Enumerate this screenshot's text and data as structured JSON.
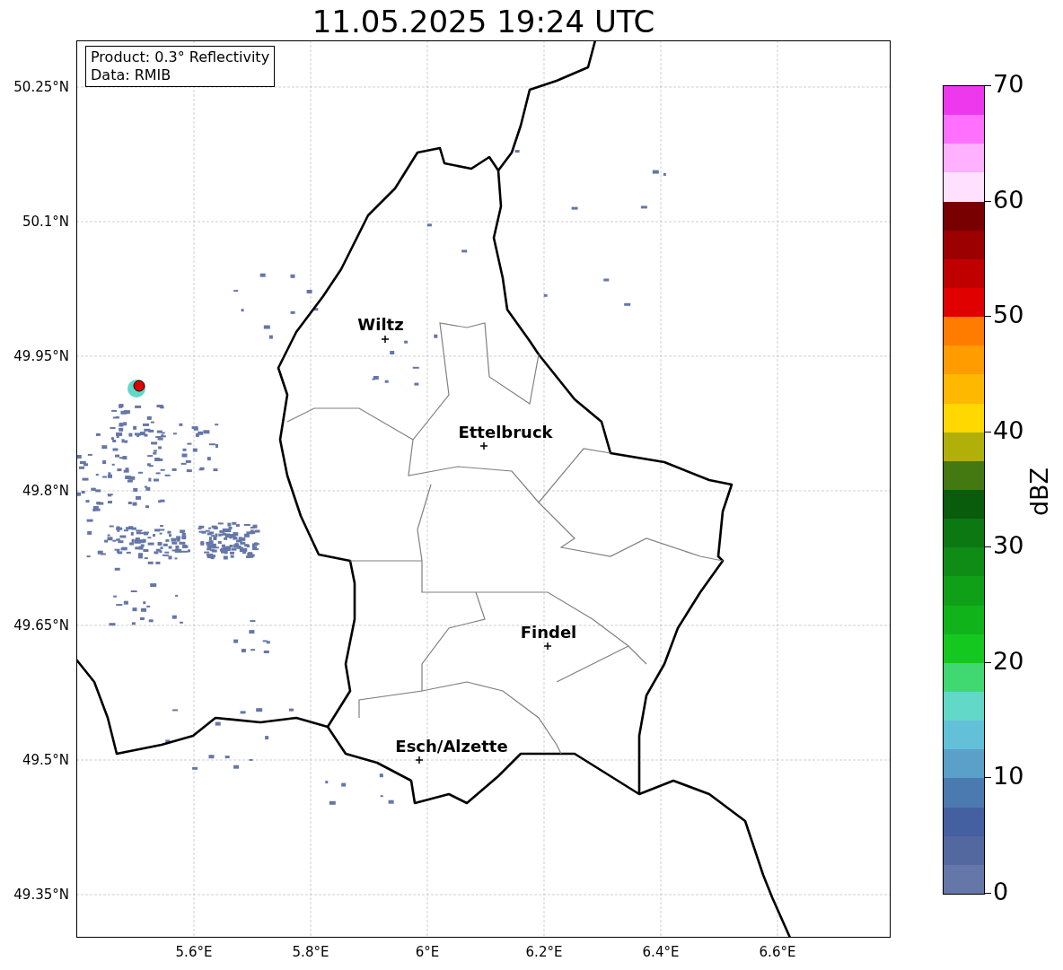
{
  "title": "11.05.2025 19:24 UTC",
  "info_box": [
    "Product: 0.3° Reflectivity",
    "Data: RMIB"
  ],
  "map": {
    "y_ticks": [
      "50.25°N",
      "50.1°N",
      "49.95°N",
      "49.8°N",
      "49.65°N",
      "49.5°N",
      "49.35°N"
    ],
    "x_ticks": [
      "5.6°E",
      "5.8°E",
      "6°E",
      "6.2°E",
      "6.4°E",
      "6.6°E"
    ],
    "cities": [
      {
        "name": "Wiltz"
      },
      {
        "name": "Ettelbruck"
      },
      {
        "name": "Findel"
      },
      {
        "name": "Esch/Alzette"
      }
    ]
  },
  "colorbar": {
    "label": "dBZ",
    "ticks": [
      "70",
      "60",
      "50",
      "40",
      "30",
      "20",
      "10",
      "0"
    ],
    "bands": [
      {
        "color": "#ee38ee"
      },
      {
        "color": "#ff70ff"
      },
      {
        "color": "#ffb0ff"
      },
      {
        "color": "#ffe0ff"
      },
      {
        "color": "#780000"
      },
      {
        "color": "#9c0000"
      },
      {
        "color": "#c00000"
      },
      {
        "color": "#e00000"
      },
      {
        "color": "#ff7c00"
      },
      {
        "color": "#ff9c00"
      },
      {
        "color": "#ffb800"
      },
      {
        "color": "#ffd800"
      },
      {
        "color": "#b0b008"
      },
      {
        "color": "#447810"
      },
      {
        "color": "#085c0c"
      },
      {
        "color": "#0c7812"
      },
      {
        "color": "#0e8c16"
      },
      {
        "color": "#10a018"
      },
      {
        "color": "#10b41a"
      },
      {
        "color": "#14c820"
      },
      {
        "color": "#40d870"
      },
      {
        "color": "#62d8c8"
      },
      {
        "color": "#62c0d8"
      },
      {
        "color": "#5aa0c8"
      },
      {
        "color": "#4a7ab0"
      },
      {
        "color": "#4560a0"
      },
      {
        "color": "#5468a0"
      },
      {
        "color": "#6577a8"
      }
    ]
  }
}
